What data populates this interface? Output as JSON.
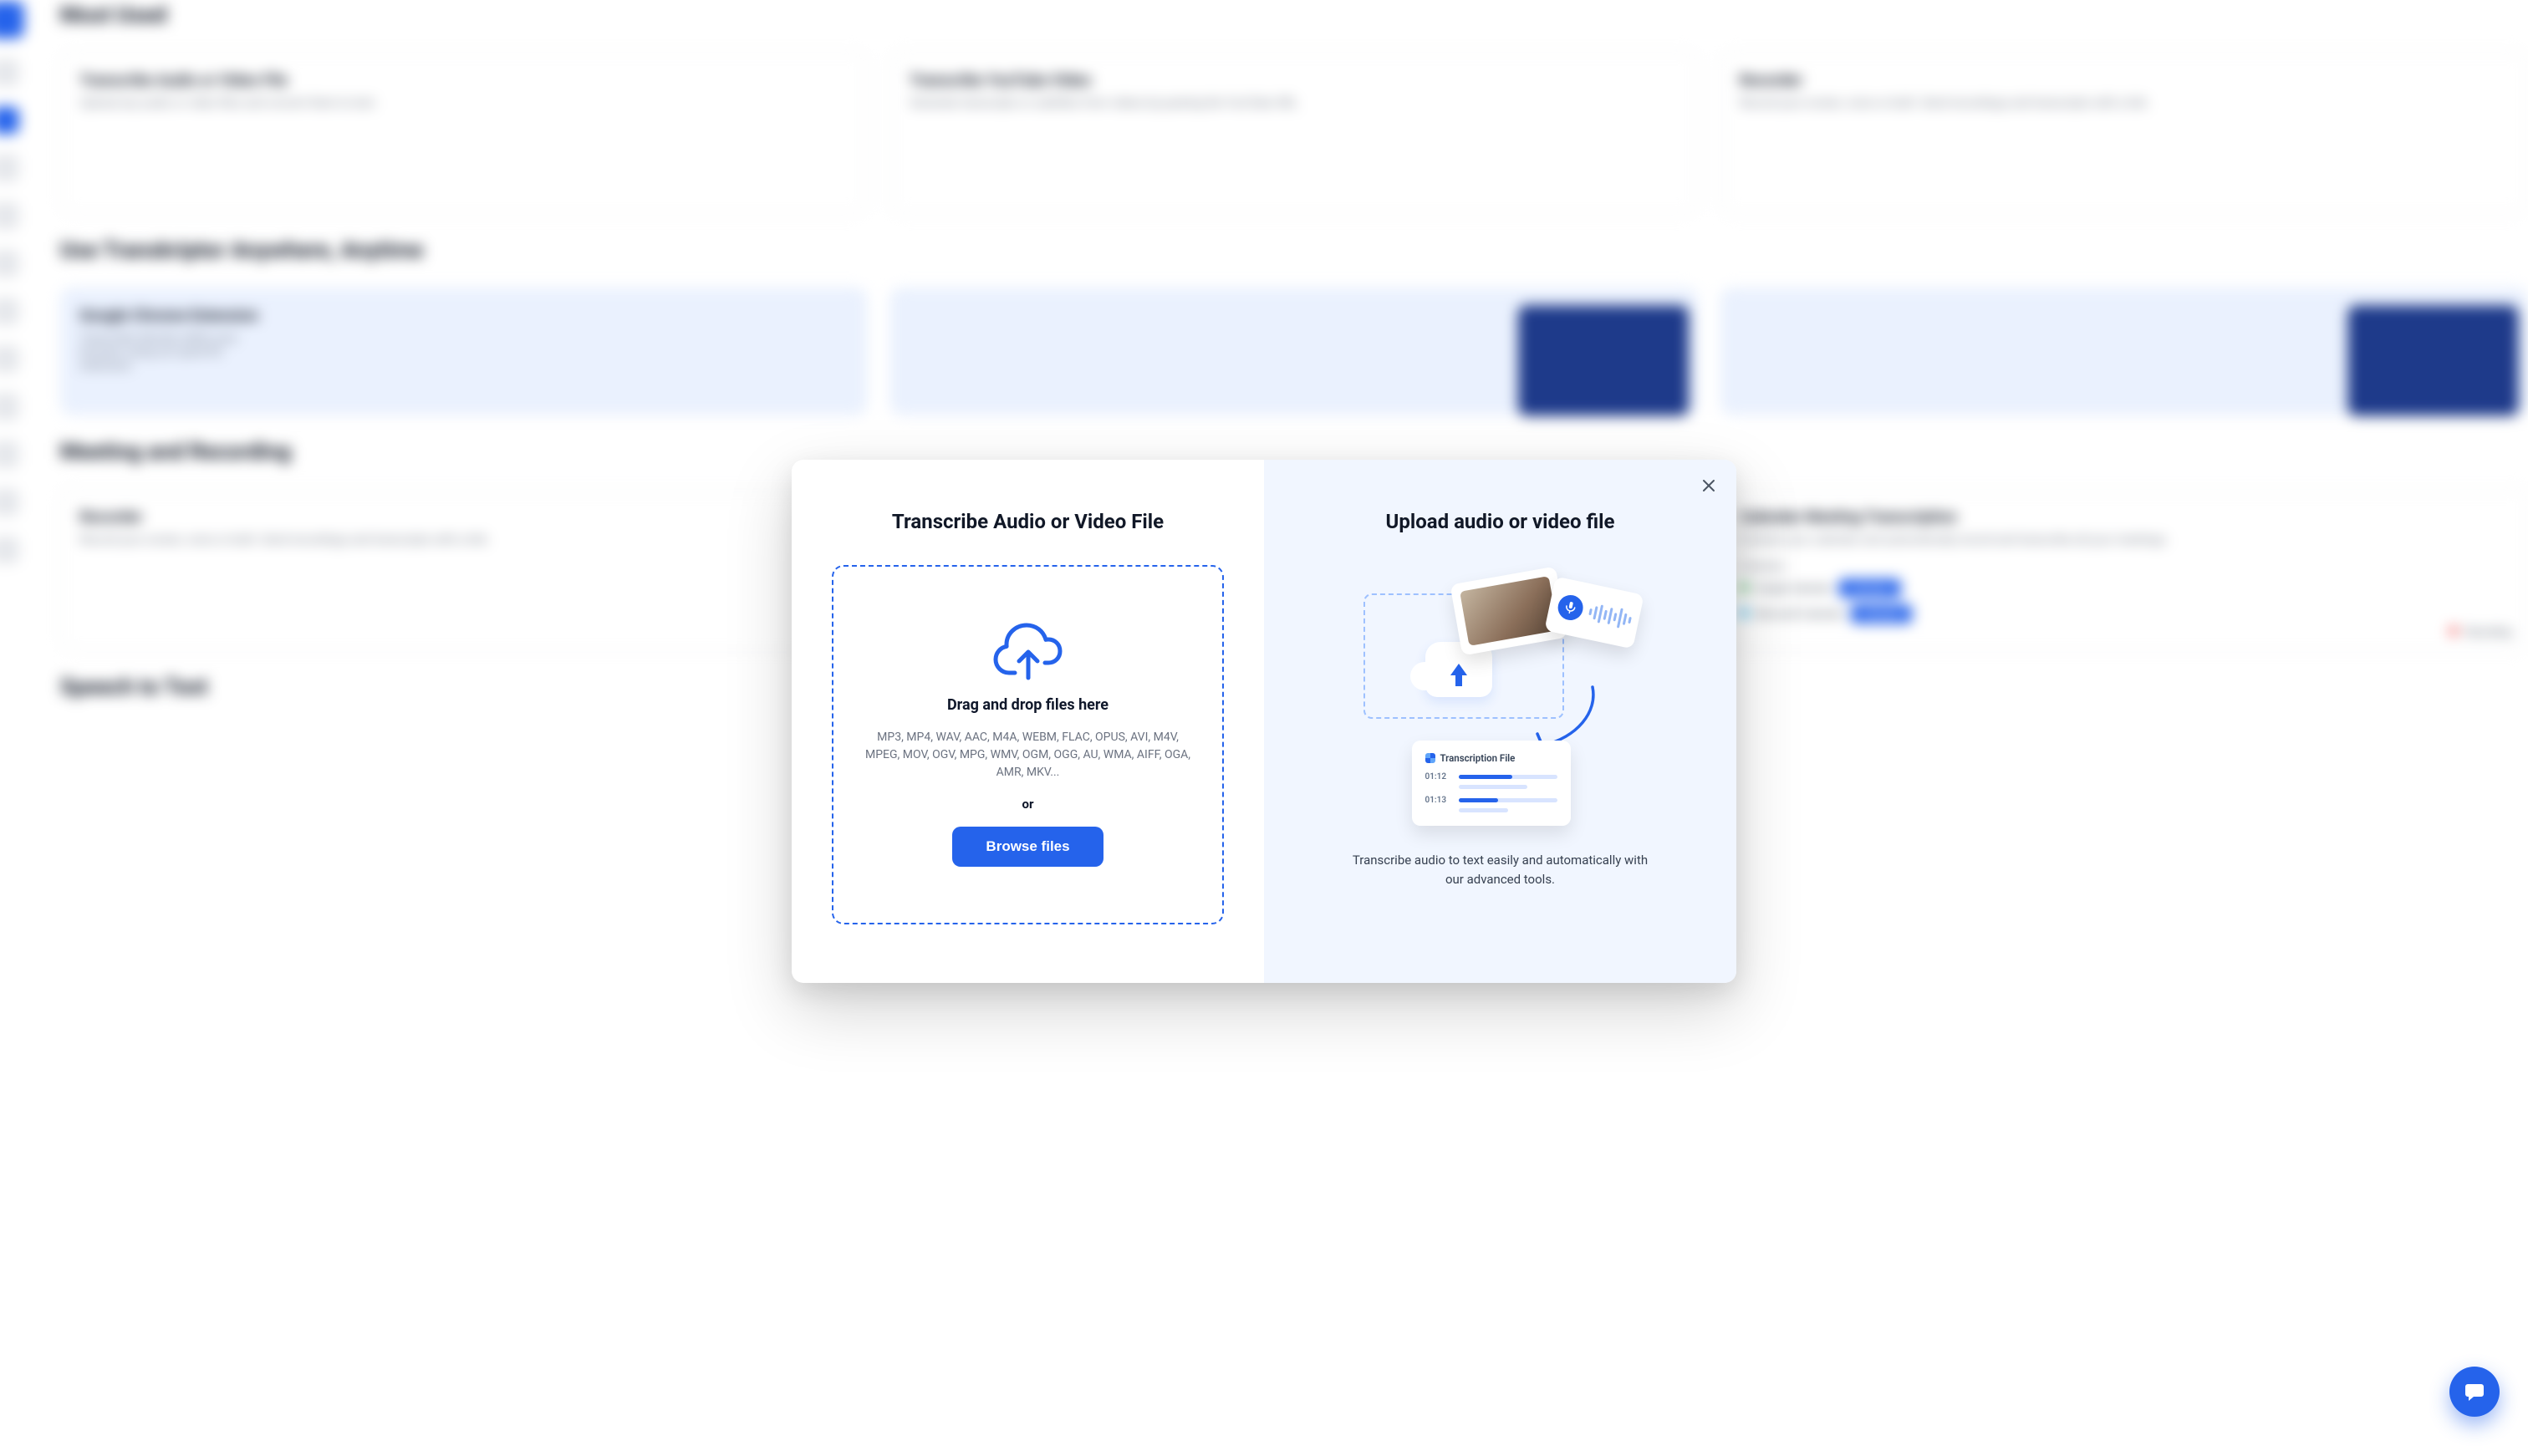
{
  "background": {
    "sections": {
      "most_used": "Most Used",
      "anywhere": "Use Transkriptor Anywhere, Anytime",
      "meeting": "Meeting and Recording",
      "stt": "Speech to Text"
    },
    "cards": {
      "transcribe_file": {
        "title": "Transcribe Audio or Video File",
        "subtitle": "Upload any audio or video files and convert them to text."
      },
      "transcribe_youtube": {
        "title": "Transcribe YouTube Video",
        "subtitle": "Generate transcripts or subtitles from videos by pasting the YouTube URL."
      },
      "recorder": {
        "title": "Recorder",
        "subtitle": "Record your screen, voice or both. Send recordings and transcripts with a link."
      },
      "chrome_ext": {
        "title": "Google Chrome Extension",
        "subtitle": "Transcribe directly within your browser using our quick-fix extension."
      },
      "recorder2": {
        "title": "Recorder",
        "subtitle": "Record your screen, voice or both. Send recordings and transcripts with a link."
      },
      "meeting_item": {
        "title": "Calendar Meeting Transcription",
        "subtitle": "Connect your calendar and automatically record and transcribe all your meetings."
      }
    },
    "calendar_panel": {
      "label": "Calendars",
      "google": "Google Calendar",
      "microsoft": "Microsoft Calendar",
      "connect": "Connect",
      "recording": "Recording"
    }
  },
  "modal": {
    "left": {
      "title": "Transcribe Audio or Video File",
      "drop_heading": "Drag and drop files here",
      "formats": "MP3, MP4, WAV, AAC, M4A, WEBM, FLAC, OPUS, AVI, M4V, MPEG, MOV, OGV, MPG, WMV, OGM, OGG, AU, WMA, AIFF, OGA, AMR, MKV...",
      "or": "or",
      "browse": "Browse files"
    },
    "right": {
      "title": "Upload audio or video file",
      "illustration": {
        "card_title": "Transcription File",
        "ts1": "01:12",
        "ts2": "01:13"
      },
      "caption": "Transcribe audio to text easily and automatically with our advanced tools."
    }
  }
}
